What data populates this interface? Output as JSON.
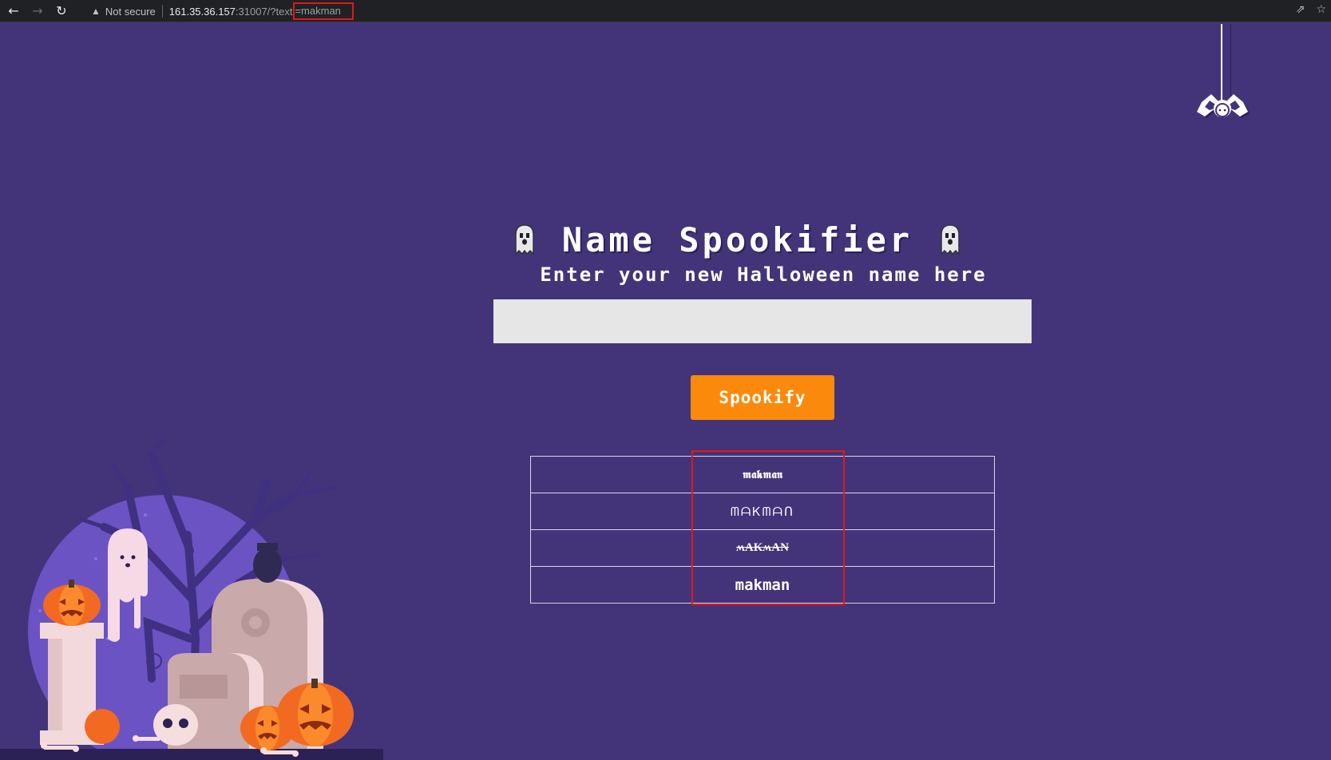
{
  "browser": {
    "back_icon": "arrow-left-icon",
    "forward_icon": "arrow-right-icon",
    "reload_icon": "reload-icon",
    "security_icon": "warning-triangle-icon",
    "security_label": "Not secure",
    "url_host": "161.35.36.157",
    "url_path": ":31007/?text",
    "url_query": "=makman",
    "share_icon": "share-icon",
    "bookmark_icon": "star-icon"
  },
  "page": {
    "title": "Name Spookifier",
    "title_icon": "ghost-icon",
    "subtitle": "Enter your new Halloween name here",
    "input_value": "",
    "input_placeholder": "",
    "button_label": "Spookify",
    "decoration": "spider-icon"
  },
  "results": [
    {
      "text": "𝖒𝖆𝖐𝖒𝖆𝖓"
    },
    {
      "text": "ᗰᗩᏦᗰᗩᑎ"
    },
    {
      "text": "ʍAKʍAN"
    },
    {
      "text": "makman"
    }
  ],
  "colors": {
    "background": "#433479",
    "button": "#fb8a0c",
    "highlight": "#e0181b",
    "input": "#e6e6e6"
  }
}
